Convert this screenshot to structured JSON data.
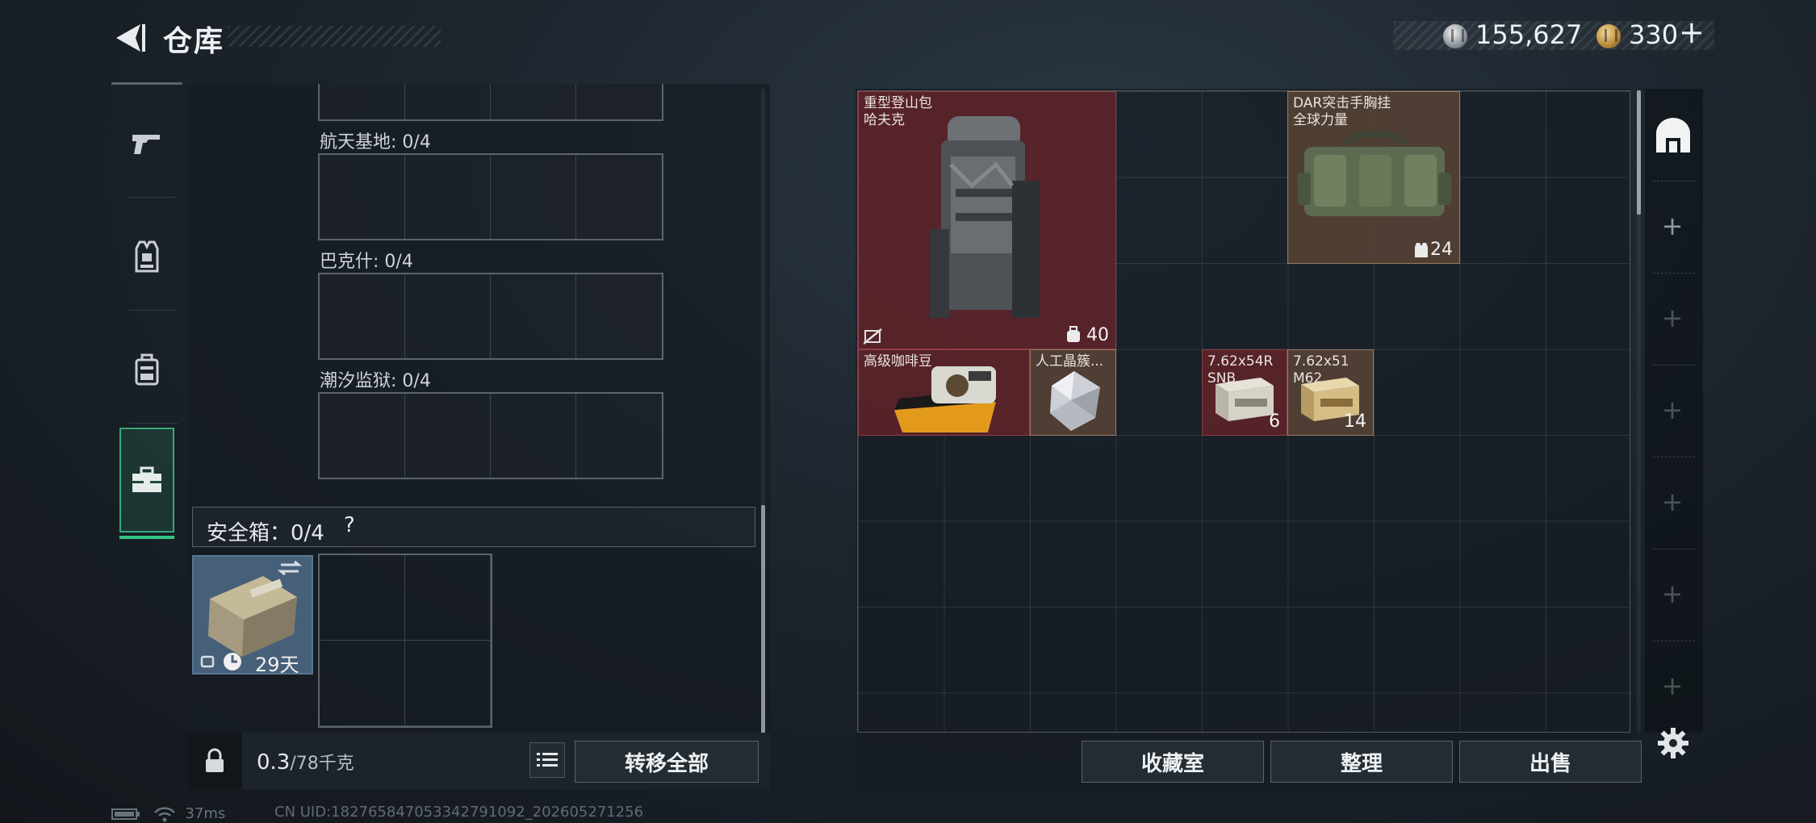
{
  "header": {
    "title": "仓库",
    "back_icon": "back-arrow-icon",
    "currency": [
      {
        "icon": "silver-coin-icon",
        "value": "155,627"
      },
      {
        "icon": "gold-coin-icon",
        "value": "330"
      }
    ],
    "add_label": "+"
  },
  "sidebar": {
    "items": [
      {
        "name": "weapons",
        "icon": "pistol-icon"
      },
      {
        "name": "vest",
        "icon": "vest-icon"
      },
      {
        "name": "backpack",
        "icon": "backpack-icon"
      },
      {
        "name": "stash-case",
        "icon": "briefcase-icon",
        "active": true
      }
    ]
  },
  "containers": {
    "sections": [
      {
        "label": "航天基地: 0/4"
      },
      {
        "label": "巴克什: 0/4"
      },
      {
        "label": "潮汐监狱: 0/4"
      }
    ],
    "safe": {
      "label": "安全箱：0/4",
      "help": "?",
      "days": "29天"
    },
    "weight": {
      "current": "0.3",
      "max": "/78千克"
    },
    "transfer_all": "转移全部"
  },
  "stash": {
    "items": [
      {
        "name": "重型登山包\n哈夫克",
        "qty": "40",
        "rarity": "red"
      },
      {
        "name": "DAR突击手胸挂\n全球力量",
        "qty": "24",
        "rarity": "brown"
      },
      {
        "name": "高级咖啡豆",
        "qty": "",
        "rarity": "red"
      },
      {
        "name": "人工晶簇...",
        "qty": "",
        "rarity": "brown"
      },
      {
        "name": "7.62x54R\nSNB",
        "qty": "6",
        "rarity": "red"
      },
      {
        "name": "7.62x51\nM62",
        "qty": "14",
        "rarity": "brown"
      }
    ],
    "buttons": {
      "collection": "收藏室",
      "sort": "整理",
      "sell": "出售"
    }
  },
  "rail": {
    "home_icon": "stash-home-icon",
    "add_label": "+"
  },
  "status": {
    "ping": "37ms",
    "uid": "CN UID:182765847053342791092_202605271256"
  },
  "colors": {
    "active_green": "#34c486",
    "rarity_red": "#68242a",
    "rarity_brown": "#5c4636"
  }
}
